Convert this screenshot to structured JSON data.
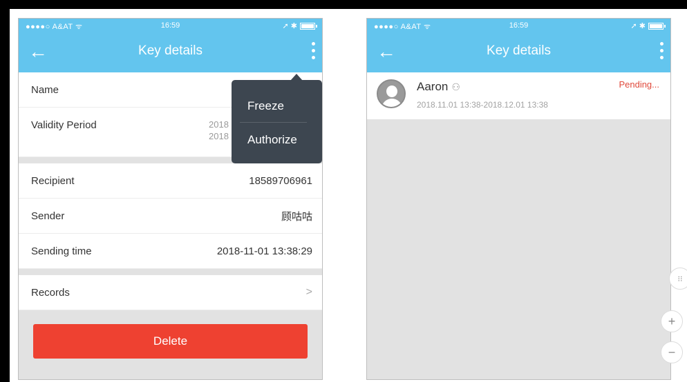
{
  "status_bar": {
    "carrier": "●●●●○ A&AT ᯤ",
    "time": "16:59",
    "icons": "➚ ✱"
  },
  "left_screen": {
    "title": "Key details",
    "rows": {
      "name_label": "Name",
      "validity_label": "Validity Period",
      "validity_value_line1": "2018",
      "validity_value_line2": "2018",
      "recipient_label": "Recipient",
      "recipient_value": "18589706961",
      "sender_label": "Sender",
      "sender_value": "顾咕咕",
      "sending_time_label": "Sending time",
      "sending_time_value": "2018-11-01 13:38:29",
      "records_label": "Records"
    },
    "delete_label": "Delete",
    "menu": {
      "freeze": "Freeze",
      "authorize": "Authorize"
    }
  },
  "right_screen": {
    "title": "Key details",
    "key": {
      "name": "Aaron",
      "period": "2018.11.01 13:38-2018.12.01 13:38",
      "status": "Pending..."
    }
  },
  "icons": [
    "back-arrow-icon",
    "more-vertical-icon",
    "user-icon",
    "chevron-right-icon",
    "avatar-icon",
    "compress-icon",
    "zoom-in-icon",
    "zoom-out-icon"
  ],
  "colors": {
    "header": "#63c5ee",
    "delete": "#ee4131",
    "popup": "#3d4650",
    "pending": "#e0493b"
  }
}
